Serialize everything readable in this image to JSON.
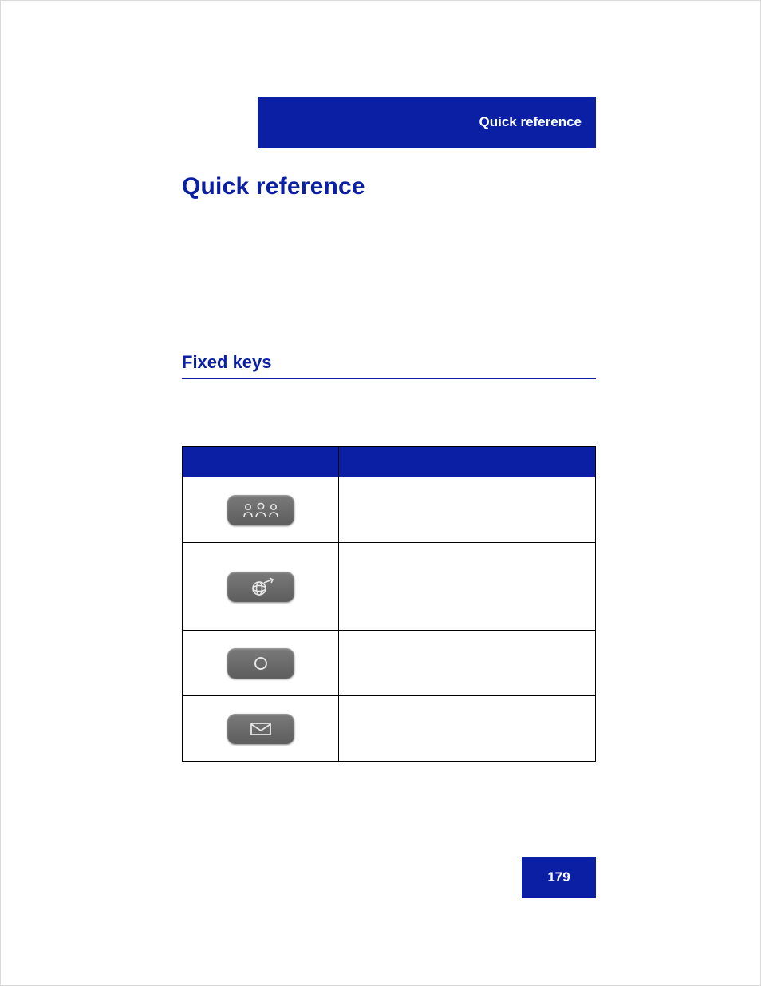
{
  "header": {
    "label": "Quick reference"
  },
  "title": "Quick reference",
  "section": {
    "heading": "Fixed keys"
  },
  "table": {
    "rows": [
      {
        "icon": "conference-icon",
        "description": ""
      },
      {
        "icon": "services-icon",
        "description": ""
      },
      {
        "icon": "record-icon",
        "description": ""
      },
      {
        "icon": "message-icon",
        "description": ""
      }
    ]
  },
  "page_number": "179"
}
